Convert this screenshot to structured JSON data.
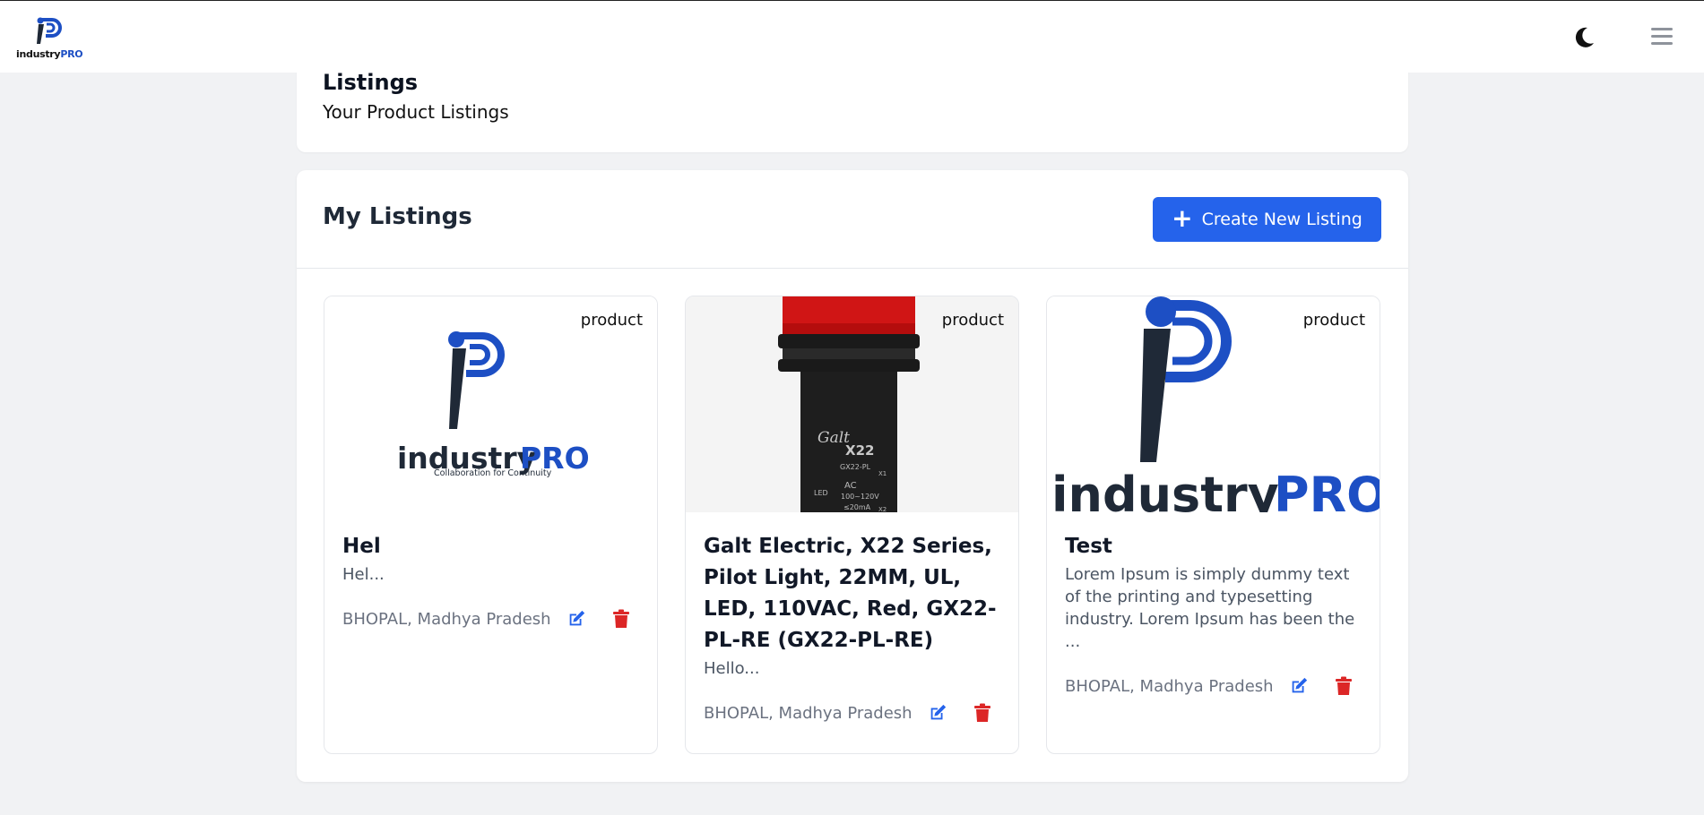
{
  "brand": {
    "name_main": "industry",
    "name_accent": "PRO",
    "tagline": "Collaboration for Continuity",
    "accent": "#1d4fc4"
  },
  "navbar": {
    "theme_toggle_icon": "moon-icon",
    "menu_icon": "hamburger-icon"
  },
  "header": {
    "title": "Listings",
    "subtitle": "Your Product Listings"
  },
  "main": {
    "title": "My Listings",
    "create_button": {
      "icon": "plus-icon",
      "label": "Create New Listing"
    },
    "accent": "#2563eb",
    "danger": "#dc2626"
  },
  "listings": [
    {
      "badge": "product",
      "title": "Hel",
      "description": "Hel...",
      "location": "BHOPAL, Madhya Pradesh",
      "image": "industrypro-logo"
    },
    {
      "badge": "product",
      "title": "Galt Electric, X22 Series, Pilot Light, 22MM, UL, LED, 110VAC, Red, GX22-PL-RE (GX22-PL-RE)",
      "description": "Hello...",
      "location": "BHOPAL, Madhya Pradesh",
      "image": "pilot-light-photo",
      "image_text": {
        "brand": "Galt",
        "model": "X22",
        "part": "GX22-PL",
        "x1": "X1",
        "ac": "AC",
        "volt": "100~120V",
        "led": "LED",
        "current": "≤20mA",
        "x2": "X2"
      }
    },
    {
      "badge": "product",
      "title": "Test",
      "description": "Lorem Ipsum is simply dummy text of the printing and typesetting industry. Lorem Ipsum has been the ...",
      "location": "BHOPAL, Madhya Pradesh",
      "image": "industrypro-logo-large"
    }
  ]
}
